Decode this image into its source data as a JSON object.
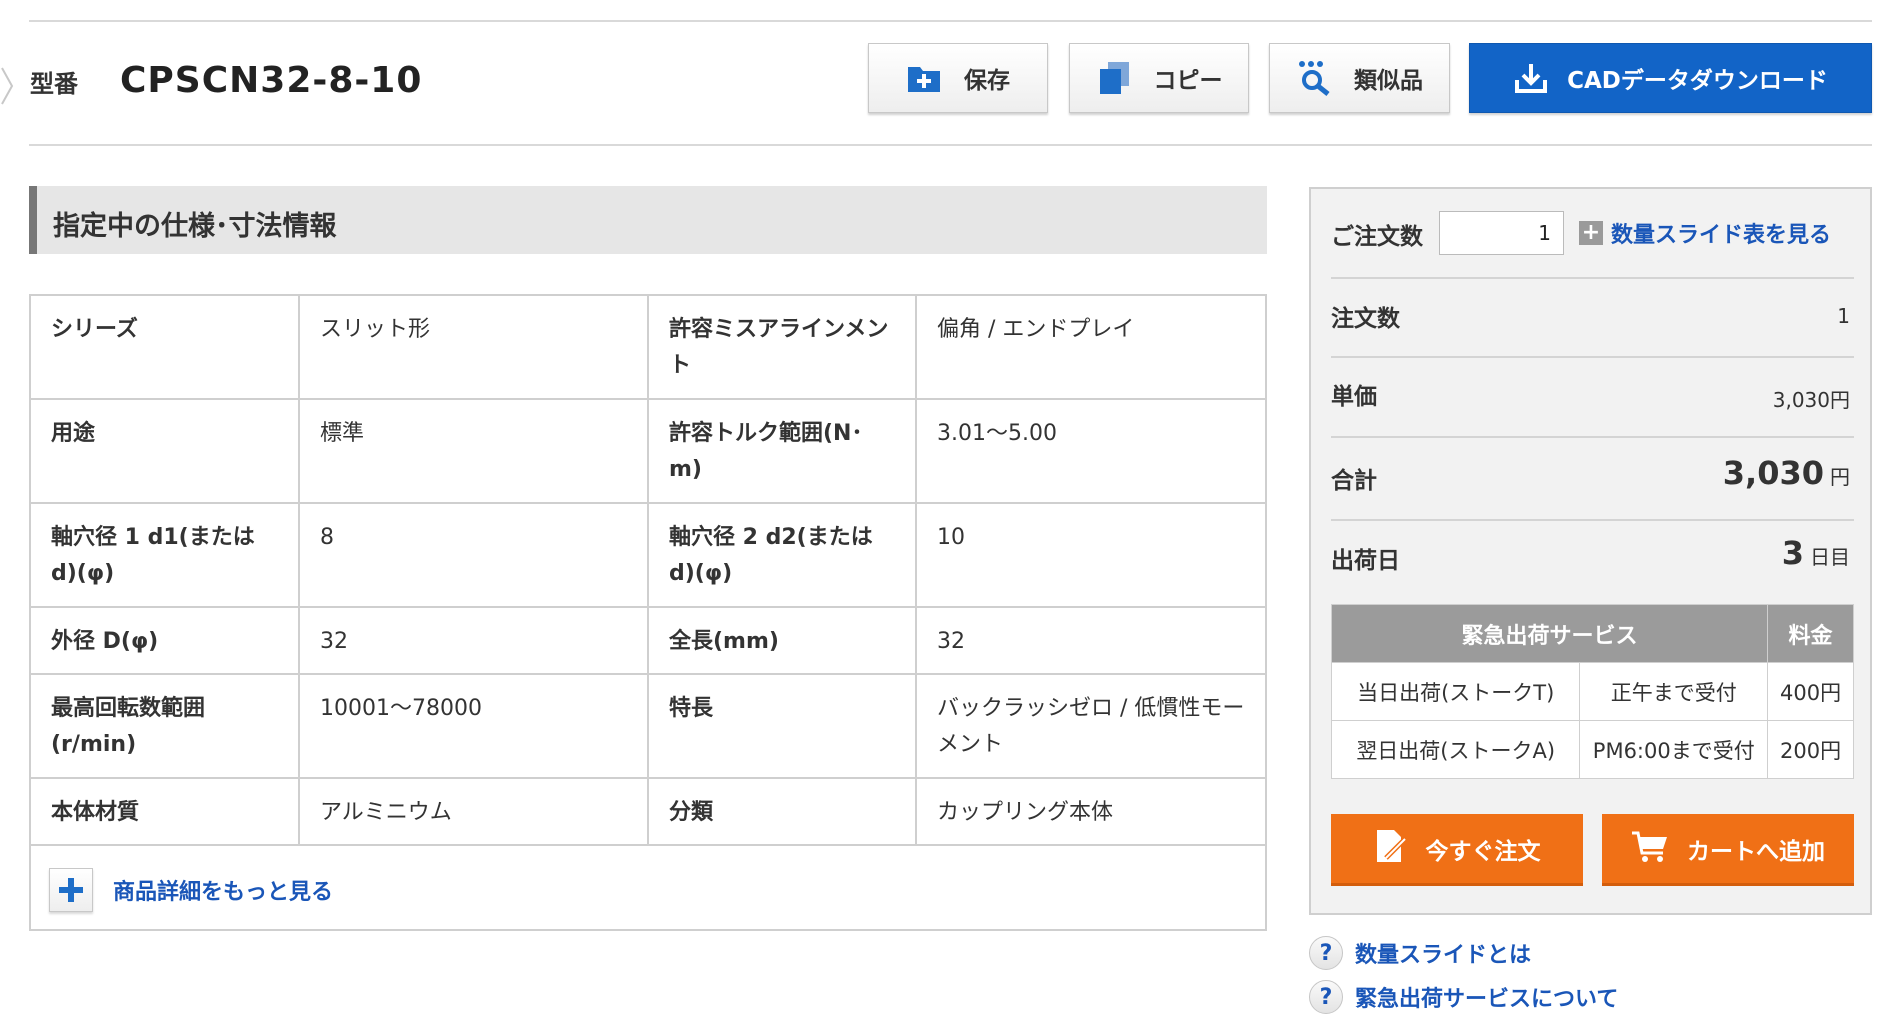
{
  "header": {
    "model_label": "型番",
    "model_value": "CPSCN32-8-10",
    "buttons": {
      "save": "保存",
      "copy": "コピー",
      "similar": "類似品",
      "cad_download": "CADデータダウンロード"
    }
  },
  "spec_section": {
    "title": "指定中の仕様･寸法情報",
    "rows": [
      {
        "k1": "シリーズ",
        "v1": "スリット形",
        "k2": "許容ミスアラインメント",
        "v2": "偏角 / エンドプレイ"
      },
      {
        "k1": "用途",
        "v1": "標準",
        "k2": "許容トルク範囲(N･m)",
        "v2": "3.01～5.00"
      },
      {
        "k1": "軸穴径 1 d1(またはd)(φ)",
        "v1": "8",
        "k2": "軸穴径 2 d2(またはd)(φ)",
        "v2": "10"
      },
      {
        "k1": "外径 D(φ)",
        "v1": "32",
        "k2": "全長(mm)",
        "v2": "32"
      },
      {
        "k1": "最高回転数範囲(r/min)",
        "v1": "10001～78000",
        "k2": "特長",
        "v2": "バックラッシゼロ / 低慣性モーメント"
      },
      {
        "k1": "本体材質",
        "v1": "アルミニウム",
        "k2": "分類",
        "v2": "カップリング本体"
      }
    ],
    "more_details": "商品詳細をもっと見る"
  },
  "order_panel": {
    "quantity_label": "ご注文数",
    "quantity_value": "1",
    "slide_table_link": "数量スライド表を見る",
    "order_count_label": "注文数",
    "order_count_value": "1",
    "unit_price_label": "単価",
    "unit_price_value": "3,030円",
    "total_label": "合計",
    "total_value": "3,030",
    "total_unit": "円",
    "ship_label": "出荷日",
    "ship_value": "3",
    "ship_unit": "日目",
    "service_table": {
      "headers": [
        "緊急出荷サービス",
        "料金"
      ],
      "rows": [
        {
          "service": "当日出荷(ストークT)",
          "cutoff": "正午まで受付",
          "fee": "400円"
        },
        {
          "service": "翌日出荷(ストークA)",
          "cutoff": "PM6:00まで受付",
          "fee": "200円"
        }
      ]
    },
    "order_now_button": "今すぐ注文",
    "add_cart_button": "カートへ追加"
  },
  "help_links": {
    "quantity_slide": "数量スライドとは",
    "urgent_service": "緊急出荷サービスについて"
  },
  "colors": {
    "primary_blue": "#1264c7",
    "link_blue": "#1a56b8",
    "order_orange": "#f07016",
    "table_header_gray": "#9b9b9b"
  }
}
